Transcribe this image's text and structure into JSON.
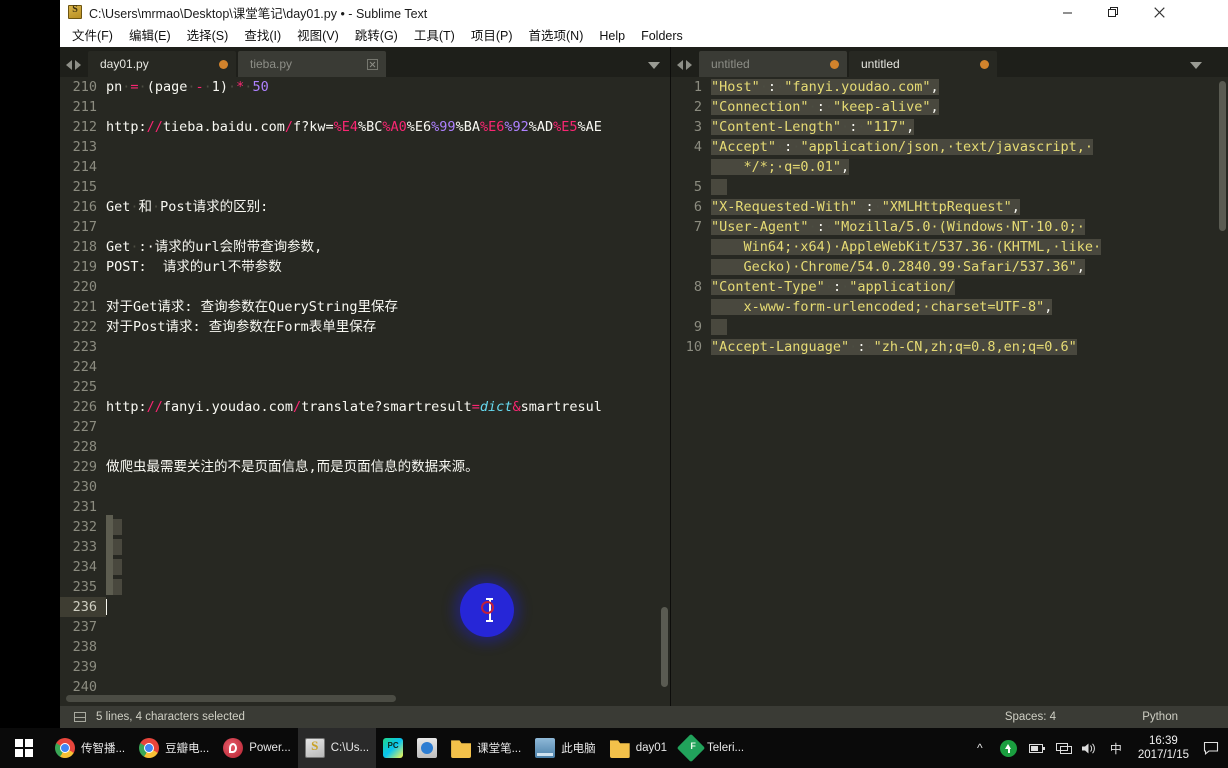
{
  "window": {
    "title": "C:\\Users\\mrmao\\Desktop\\课堂笔记\\day01.py • - Sublime Text",
    "icon": "sublime-icon",
    "buttons": {
      "minimize": "—",
      "maximize": "❐",
      "close": "✕"
    }
  },
  "menubar": {
    "items": [
      {
        "label": "文件(F)"
      },
      {
        "label": "编辑(E)"
      },
      {
        "label": "选择(S)"
      },
      {
        "label": "查找(I)"
      },
      {
        "label": "视图(V)"
      },
      {
        "label": "跳转(G)"
      },
      {
        "label": "工具(T)"
      },
      {
        "label": "项目(P)"
      },
      {
        "label": "首选项(N)"
      },
      {
        "label": "Help"
      },
      {
        "label": "Folders"
      }
    ]
  },
  "left_pane": {
    "tabs": [
      {
        "label": "day01.py",
        "state": "active",
        "marker": "dirty-dot"
      },
      {
        "label": "tieba.py",
        "state": "inactive",
        "marker": "close-x"
      }
    ],
    "status": {
      "selection": "5 lines, 4 characters selected",
      "spaces": "Spaces: 4",
      "language": "Python"
    },
    "lines": [
      {
        "n": "210",
        "tokens": [
          {
            "t": "pn",
            "c": "s-id"
          },
          {
            "t": "·",
            "c": "s-ws"
          },
          {
            "t": "=",
            "c": "s-op"
          },
          {
            "t": "·",
            "c": "s-ws"
          },
          {
            "t": "(page",
            "c": "s-id"
          },
          {
            "t": "·",
            "c": "s-ws"
          },
          {
            "t": "-",
            "c": "s-op"
          },
          {
            "t": "·",
            "c": "s-ws"
          },
          {
            "t": "1)",
            "c": "s-id"
          },
          {
            "t": "·",
            "c": "s-ws"
          },
          {
            "t": "*",
            "c": "s-op"
          },
          {
            "t": "·",
            "c": "s-ws"
          },
          {
            "t": "50",
            "c": "s-num"
          }
        ]
      },
      {
        "n": "211",
        "tokens": []
      },
      {
        "n": "212",
        "tokens": [
          {
            "t": "http:",
            "c": "s-id"
          },
          {
            "t": "//",
            "c": "s-op"
          },
          {
            "t": "tieba.baidu.com",
            "c": "s-id"
          },
          {
            "t": "/",
            "c": "s-op"
          },
          {
            "t": "f?kw=",
            "c": "s-id"
          },
          {
            "t": "%E4",
            "c": "s-esc"
          },
          {
            "t": "%BC",
            "c": "s-id"
          },
          {
            "t": "%A0",
            "c": "s-esc"
          },
          {
            "t": "%E6",
            "c": "s-id"
          },
          {
            "t": "%99",
            "c": "s-num"
          },
          {
            "t": "%BA",
            "c": "s-id"
          },
          {
            "t": "%E6",
            "c": "s-esc"
          },
          {
            "t": "%92",
            "c": "s-num"
          },
          {
            "t": "%AD",
            "c": "s-id"
          },
          {
            "t": "%E5",
            "c": "s-esc"
          },
          {
            "t": "%AE",
            "c": "s-id"
          }
        ]
      },
      {
        "n": "213",
        "tokens": []
      },
      {
        "n": "214",
        "tokens": []
      },
      {
        "n": "215",
        "tokens": []
      },
      {
        "n": "216",
        "tokens": [
          {
            "t": "Get",
            "c": "s-id"
          },
          {
            "t": "·",
            "c": "s-ws"
          },
          {
            "t": "和",
            "c": "s-id"
          },
          {
            "t": "·",
            "c": "s-ws"
          },
          {
            "t": "Post请求的区别:",
            "c": "s-id"
          }
        ]
      },
      {
        "n": "217",
        "tokens": []
      },
      {
        "n": "218",
        "tokens": [
          {
            "t": "Get",
            "c": "s-id"
          },
          {
            "t": "·",
            "c": "s-ws"
          },
          {
            "t": ":·请求的url会附带查询参数,",
            "c": "s-id"
          }
        ]
      },
      {
        "n": "219",
        "tokens": [
          {
            "t": "POST:  请求的url不带参数",
            "c": "s-id"
          }
        ]
      },
      {
        "n": "220",
        "tokens": []
      },
      {
        "n": "221",
        "tokens": [
          {
            "t": "对于Get请求: 查询参数在QueryString里保存",
            "c": "s-id"
          }
        ]
      },
      {
        "n": "222",
        "tokens": [
          {
            "t": "对于Post请求: 查询参数在Form表单里保存",
            "c": "s-id"
          }
        ]
      },
      {
        "n": "223",
        "tokens": []
      },
      {
        "n": "224",
        "tokens": []
      },
      {
        "n": "225",
        "tokens": []
      },
      {
        "n": "226",
        "tokens": [
          {
            "t": "http:",
            "c": "s-id"
          },
          {
            "t": "//",
            "c": "s-op"
          },
          {
            "t": "fanyi.youdao.com",
            "c": "s-id"
          },
          {
            "t": "/",
            "c": "s-op"
          },
          {
            "t": "translate?smartresult",
            "c": "s-id"
          },
          {
            "t": "=",
            "c": "s-op"
          },
          {
            "t": "dict",
            "c": "s-kw"
          },
          {
            "t": "&",
            "c": "s-op"
          },
          {
            "t": "smartresul",
            "c": "s-id"
          }
        ]
      },
      {
        "n": "227",
        "tokens": []
      },
      {
        "n": "228",
        "tokens": []
      },
      {
        "n": "229",
        "tokens": [
          {
            "t": "做爬虫最需要关注的不是页面信息,而是页面信息的数据来源。",
            "c": "s-id"
          }
        ]
      },
      {
        "n": "230",
        "tokens": []
      },
      {
        "n": "231",
        "tokens": []
      },
      {
        "n": "232",
        "tokens": [],
        "selected": true
      },
      {
        "n": "233",
        "tokens": [],
        "selected": true
      },
      {
        "n": "234",
        "tokens": [],
        "selected": true
      },
      {
        "n": "235",
        "tokens": [],
        "selected": true
      },
      {
        "n": "236",
        "tokens": [],
        "current": true,
        "caret": true
      },
      {
        "n": "237",
        "tokens": []
      },
      {
        "n": "238",
        "tokens": []
      },
      {
        "n": "239",
        "tokens": []
      },
      {
        "n": "240",
        "tokens": []
      }
    ]
  },
  "right_pane": {
    "tabs": [
      {
        "label": "untitled",
        "state": "inactive",
        "marker": "dirty-dot"
      },
      {
        "label": "untitled",
        "state": "active",
        "marker": "dirty-dot"
      }
    ],
    "lines": [
      {
        "n": "1",
        "tokens": [
          {
            "t": "\"Host\"",
            "c": "s-str"
          },
          {
            "t": "·",
            "c": "s-ws"
          },
          {
            "t": ":",
            "c": "s-punct"
          },
          {
            "t": "·",
            "c": "s-ws"
          },
          {
            "t": "\"fanyi.youdao.com\"",
            "c": "s-str"
          },
          {
            "t": ",",
            "c": "s-punct"
          }
        ],
        "selected": true
      },
      {
        "n": "2",
        "tokens": [
          {
            "t": "\"Connection\"",
            "c": "s-str"
          },
          {
            "t": "·",
            "c": "s-ws"
          },
          {
            "t": ":",
            "c": "s-punct"
          },
          {
            "t": "·",
            "c": "s-ws"
          },
          {
            "t": "\"keep-alive\"",
            "c": "s-str"
          },
          {
            "t": ",",
            "c": "s-punct"
          }
        ],
        "selected": true
      },
      {
        "n": "3",
        "tokens": [
          {
            "t": "\"Content-Length\"",
            "c": "s-str"
          },
          {
            "t": "·",
            "c": "s-ws"
          },
          {
            "t": ":",
            "c": "s-punct"
          },
          {
            "t": "·",
            "c": "s-ws"
          },
          {
            "t": "\"117\"",
            "c": "s-str"
          },
          {
            "t": ",",
            "c": "s-punct"
          }
        ],
        "selected": true
      },
      {
        "n": "4",
        "tokens": [
          {
            "t": "\"Accept\"",
            "c": "s-str"
          },
          {
            "t": "·",
            "c": "s-ws"
          },
          {
            "t": ":",
            "c": "s-punct"
          },
          {
            "t": "·",
            "c": "s-ws"
          },
          {
            "t": "\"application/json,·text/javascript,·",
            "c": "s-str"
          }
        ],
        "selected": true
      },
      {
        "n": "",
        "tokens": [
          {
            "t": "    */*;·q=0.01\"",
            "c": "s-str"
          },
          {
            "t": ",",
            "c": "s-punct"
          }
        ],
        "selected": true,
        "wrap": true
      },
      {
        "n": "5",
        "tokens": [],
        "selected": true
      },
      {
        "n": "6",
        "tokens": [
          {
            "t": "\"X-Requested-With\"",
            "c": "s-str"
          },
          {
            "t": "·",
            "c": "s-ws"
          },
          {
            "t": ":",
            "c": "s-punct"
          },
          {
            "t": "·",
            "c": "s-ws"
          },
          {
            "t": "\"XMLHttpRequest\"",
            "c": "s-str"
          },
          {
            "t": ",",
            "c": "s-punct"
          }
        ],
        "selected": true
      },
      {
        "n": "7",
        "tokens": [
          {
            "t": "\"User-Agent\"",
            "c": "s-str"
          },
          {
            "t": "·",
            "c": "s-ws"
          },
          {
            "t": ":",
            "c": "s-punct"
          },
          {
            "t": "·",
            "c": "s-ws"
          },
          {
            "t": "\"Mozilla/5.0·(Windows·NT·10.0;·",
            "c": "s-str"
          }
        ],
        "selected": true
      },
      {
        "n": "",
        "tokens": [
          {
            "t": "    Win64;·x64)·AppleWebKit/537.36·(KHTML,·like·",
            "c": "s-str"
          }
        ],
        "selected": true,
        "wrap": true
      },
      {
        "n": "",
        "tokens": [
          {
            "t": "    Gecko)·Chrome/54.0.2840.99·Safari/537.36\"",
            "c": "s-str"
          },
          {
            "t": ",",
            "c": "s-punct"
          }
        ],
        "selected": true,
        "wrap": true
      },
      {
        "n": "8",
        "tokens": [
          {
            "t": "\"Content-Type\"",
            "c": "s-str"
          },
          {
            "t": "·",
            "c": "s-ws"
          },
          {
            "t": ":",
            "c": "s-punct"
          },
          {
            "t": "·",
            "c": "s-ws"
          },
          {
            "t": "\"application/",
            "c": "s-str"
          }
        ],
        "selected": true
      },
      {
        "n": "",
        "tokens": [
          {
            "t": "    x-www-form-urlencoded;·charset=UTF-8\"",
            "c": "s-str"
          },
          {
            "t": ",",
            "c": "s-punct"
          }
        ],
        "selected": true,
        "wrap": true
      },
      {
        "n": "9",
        "tokens": [],
        "selected": true
      },
      {
        "n": "10",
        "tokens": [
          {
            "t": "\"Accept-Language\"",
            "c": "s-str"
          },
          {
            "t": "·",
            "c": "s-ws"
          },
          {
            "t": ":",
            "c": "s-punct"
          },
          {
            "t": "·",
            "c": "s-ws"
          },
          {
            "t": "\"zh-CN,zh;q=0.8,en;q=0.6\"",
            "c": "s-str"
          }
        ],
        "selected": true
      }
    ]
  },
  "taskbar": {
    "start": "start-button",
    "items": [
      {
        "label": "传智播...",
        "icon": "chrome-icon",
        "active": false
      },
      {
        "label": "豆瓣电...",
        "icon": "chrome-icon",
        "active": false
      },
      {
        "label": "Power...",
        "icon": "powershell-icon",
        "active": false
      },
      {
        "label": "C:\\Us...",
        "icon": "sublime-icon",
        "active": true
      },
      {
        "label": "",
        "icon": "pycharm-icon",
        "active": false
      },
      {
        "label": "",
        "icon": "fiddler-icon",
        "active": false
      },
      {
        "label": "课堂笔...",
        "icon": "folder-icon",
        "active": false
      },
      {
        "label": "此电脑",
        "icon": "this-pc-icon",
        "active": false
      },
      {
        "label": "day01",
        "icon": "folder-icon",
        "active": false
      },
      {
        "label": "Teleri...",
        "icon": "telerik-icon",
        "active": false
      }
    ],
    "tray": {
      "chevron": "^",
      "ime": "中",
      "time": "16:39",
      "date": "2017/1/15"
    }
  },
  "colors": {
    "editor_bg": "#272822",
    "tab_active": "#272822",
    "tab_inactive": "#3a3b35",
    "gutter_text": "#8c8c80",
    "string": "#e6db74",
    "operator": "#f92672",
    "number": "#ae81ff",
    "keyword": "#66d9ef",
    "selection": "#49483e",
    "status_bg": "#3a3b35",
    "dirty_dot": "#d2832c",
    "click_indicator": "#2626ff"
  }
}
